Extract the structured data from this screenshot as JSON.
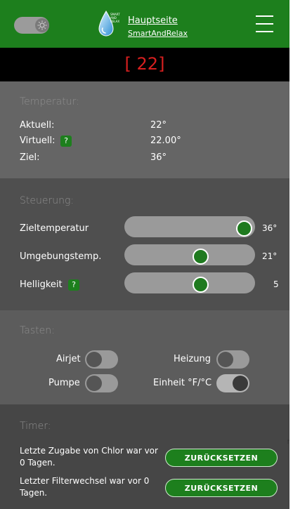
{
  "header": {
    "brand_lines": [
      "SMART",
      "AND",
      "RELAX"
    ],
    "nav_home": "Hauptseite",
    "nav_sub": "SmartAndRelax",
    "theme_toggle_icon": "sun-icon",
    "menu_icon": "hamburger-icon",
    "colors": {
      "bar": "#1d7f1d"
    }
  },
  "target": {
    "display": "[ 22]",
    "color": "#d71f1f"
  },
  "temperature": {
    "title": "Temperatur:",
    "rows": [
      {
        "label": "Aktuell:",
        "value": "22°",
        "help": false
      },
      {
        "label": "Virtuell:",
        "value": "22.00°",
        "help": true,
        "help_text": "?"
      },
      {
        "label": "Ziel:",
        "value": "36°",
        "help": false
      }
    ]
  },
  "control": {
    "title": "Steuerung:",
    "sliders": [
      {
        "label": "Zieltemperatur",
        "value_text": "36°",
        "fraction": 1.0,
        "help": false
      },
      {
        "label": "Umgebungstemp.",
        "value_text": "21°",
        "fraction": 0.6,
        "help": false
      },
      {
        "label": "Helligkeit",
        "value_text": "5",
        "fraction": 0.6,
        "help": true,
        "help_text": "?"
      }
    ]
  },
  "keys": {
    "title": "Tasten:",
    "toggles": [
      {
        "label": "Airjet",
        "on": false
      },
      {
        "label": "Heizung",
        "on": false
      },
      {
        "label": "Pumpe",
        "on": false
      },
      {
        "label": "Einheit °F/°C",
        "on": true
      }
    ]
  },
  "timer": {
    "title": "Timer:",
    "rows": [
      {
        "text": "Letzte Zugabe von Chlor war vor 0 Tagen.",
        "button": "ZURÜCKSETZEN"
      },
      {
        "text": "Letzter Filterwechsel war vor 0 Tagen.",
        "button": "ZURÜCKSETZEN"
      }
    ]
  }
}
